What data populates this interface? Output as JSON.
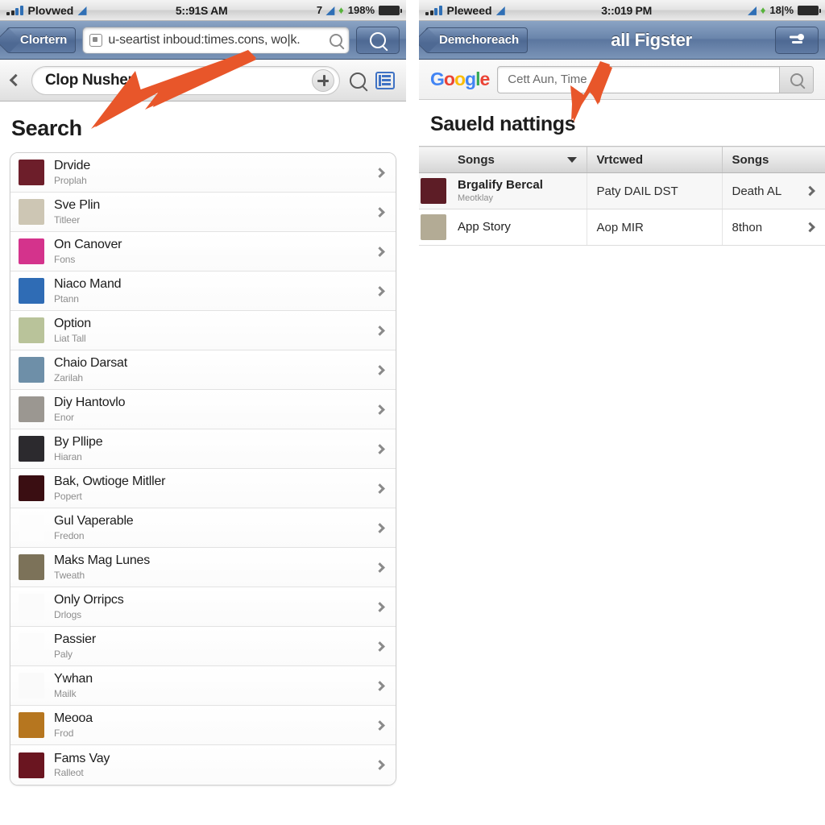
{
  "left": {
    "status": {
      "carrier": "Plovwed",
      "time": "5::91S AM",
      "signal_number": "7",
      "battery_pct": "19⁠8%",
      "wifi_icon": "wifi-icon",
      "battery_icon": "battery-icon"
    },
    "navbar": {
      "back_label": "Clortern",
      "url_value": "u-seartist inboud:times.cons, wo|k.",
      "search_button_icon": "search-icon",
      "page_icon": "page-icon"
    },
    "toolbar": {
      "back_icon": "chevron-left-icon",
      "title": "Clop Nusher",
      "add_icon": "plus-circle-icon",
      "search_icon": "search-icon",
      "reader_icon": "reader-list-icon"
    },
    "page_title": "Search",
    "rows": [
      {
        "title": "Drvide",
        "subtitle": "Proplah",
        "thumb": "#6d1e2a"
      },
      {
        "title": "Sve Plin",
        "subtitle": "Titleer",
        "thumb": "#cdc6b4"
      },
      {
        "title": "On Canover",
        "subtitle": "Fons",
        "thumb": "#d4338c"
      },
      {
        "title": "Niaco Mand",
        "subtitle": "Ptann",
        "thumb": "#2f6cb5"
      },
      {
        "title": "Option",
        "subtitle": "Liat Tall",
        "thumb": "#b9c39a"
      },
      {
        "title": "Chaio Darsat",
        "subtitle": "Zarilah",
        "thumb": "#6e8fa8"
      },
      {
        "title": "Diy Hantovlo",
        "subtitle": "Enor",
        "thumb": "#9b9791"
      },
      {
        "title": "By Pllipe",
        "subtitle": "Hiaran",
        "thumb": "#2c2a2e"
      },
      {
        "title": "Bak, Owtioge Mitller",
        "subtitle": "Popert",
        "thumb": "#3a0e12"
      },
      {
        "title": "Gul Vaperable",
        "subtitle": "Fredon",
        "thumb": "#fdfdfd"
      },
      {
        "title": "Maks Mag Lunes",
        "subtitle": "Tweath",
        "thumb": "#7c7259"
      },
      {
        "title": "Only Orripcs",
        "subtitle": "Drlogs",
        "thumb": "#fbfbfb"
      },
      {
        "title": "Passier",
        "subtitle": "Paly",
        "thumb": "#fcfcfc"
      },
      {
        "title": "Ywhan",
        "subtitle": "Mailk",
        "thumb": "#fafafa"
      },
      {
        "title": "Meooa",
        "subtitle": "Frod",
        "thumb": "#b6761f"
      },
      {
        "title": "Fams Vay",
        "subtitle": "Ralleot",
        "thumb": "#6a1520"
      }
    ]
  },
  "right": {
    "status": {
      "carrier": "Pleweed",
      "time": "3::019 PM",
      "battery_pct": "18|%",
      "wifi_icon": "wifi-icon",
      "battery_icon": "battery-icon"
    },
    "navbar": {
      "back_label": "Demchoreach",
      "title": "all Figster",
      "filter_icon": "filter-sliders-icon"
    },
    "google": {
      "logo": "google-logo",
      "search_value": "Cett Aun, Time",
      "search_button_icon": "search-icon"
    },
    "section_title": "Saueld nattings",
    "table": {
      "columns": [
        "Songs",
        "Vrtcwed",
        "Songs"
      ],
      "sort_icon": "caret-down-icon",
      "rows": [
        {
          "title": "Brgalify Bercal",
          "subtitle": "Meotklay",
          "col2": "Paty DAIL DST",
          "col3": "Death AL",
          "thumb": "#5d1d26",
          "bold": true
        },
        {
          "title": "App Story",
          "subtitle": "",
          "col2": "Aop MIR",
          "col3": "8thon",
          "thumb": "#b3ab95",
          "bold": false
        }
      ]
    }
  },
  "annotations": {
    "arrow_color": "#e8562a",
    "left_arrow_name": "callout-arrow-left",
    "right_arrow_name": "callout-arrow-right"
  }
}
